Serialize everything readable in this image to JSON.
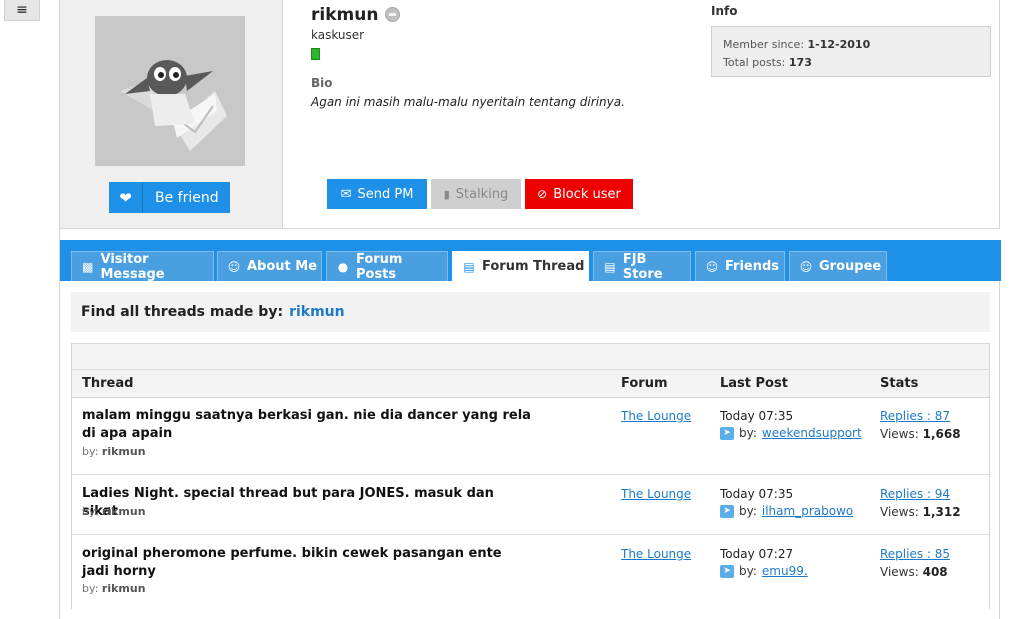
{
  "topbar": {
    "menu_icon": "hamburger-icon",
    "menu_glyph": "≡"
  },
  "profile": {
    "avatar_icon": "kaskus-mascot-avatar-icon",
    "be_friend_label": "Be friend",
    "username": "rikmun",
    "user_title": "kaskuser",
    "bio_label": "Bio",
    "bio_text": "Agan ini masih malu-malu nyeritain tentang dirinya.",
    "buttons": {
      "send_pm": "Send PM",
      "stalking": "Stalking",
      "block_user": "Block user"
    },
    "info": {
      "label": "Info",
      "member_since_label": "Member since:",
      "member_since": "1-12-2010",
      "total_posts_label": "Total posts:",
      "total_posts": "173"
    }
  },
  "tabs": [
    {
      "label": "Visitor Message",
      "icon": "message-board-icon",
      "active": false
    },
    {
      "label": "About Me",
      "icon": "person-icon",
      "active": false
    },
    {
      "label": "Forum Posts",
      "icon": "speech-bubble-icon",
      "active": false
    },
    {
      "label": "Forum Thread",
      "icon": "calendar-icon",
      "active": true
    },
    {
      "label": "FJB Store",
      "icon": "shopping-cart-icon",
      "active": false
    },
    {
      "label": "Friends",
      "icon": "person-icon",
      "active": false
    },
    {
      "label": "Groupee",
      "icon": "group-icon",
      "active": false
    }
  ],
  "find": {
    "label": "Find all threads made by:",
    "user": "rikmun"
  },
  "table": {
    "headers": {
      "thread": "Thread",
      "forum": "Forum",
      "last_post": "Last Post",
      "stats": "Stats"
    },
    "rows": [
      {
        "title": "malam minggu saatnya berkasi gan. nie dia dancer yang rela di apa apain",
        "by_label": "by:",
        "author": "rikmun",
        "forum": "The Lounge",
        "time": "Today 07:35",
        "last_by_label": "by:",
        "last_by": "weekendsupport",
        "replies": "Replies : 87",
        "views_label": "Views:",
        "views": "1,668"
      },
      {
        "title": "Ladies Night. special thread but para JONES. masuk dan sikat",
        "by_label": "by:",
        "author": "rikmun",
        "forum": "The Lounge",
        "time": "Today 07:35",
        "last_by_label": "by:",
        "last_by": "ilham_prabowo",
        "replies": "Replies : 94",
        "views_label": "Views:",
        "views": "1,312"
      },
      {
        "title": "original pheromone perfume. bikin cewek pasangan ente jadi horny",
        "by_label": "by:",
        "author": "rikmun",
        "forum": "The Lounge",
        "time": "Today 07:27",
        "last_by_label": "by:",
        "last_by": "emu99.",
        "replies": "Replies : 85",
        "views_label": "Views:",
        "views": "408"
      }
    ]
  },
  "colors": {
    "accent": "#1e90e8",
    "block": "#ee0000",
    "link": "#1e7ac8"
  }
}
